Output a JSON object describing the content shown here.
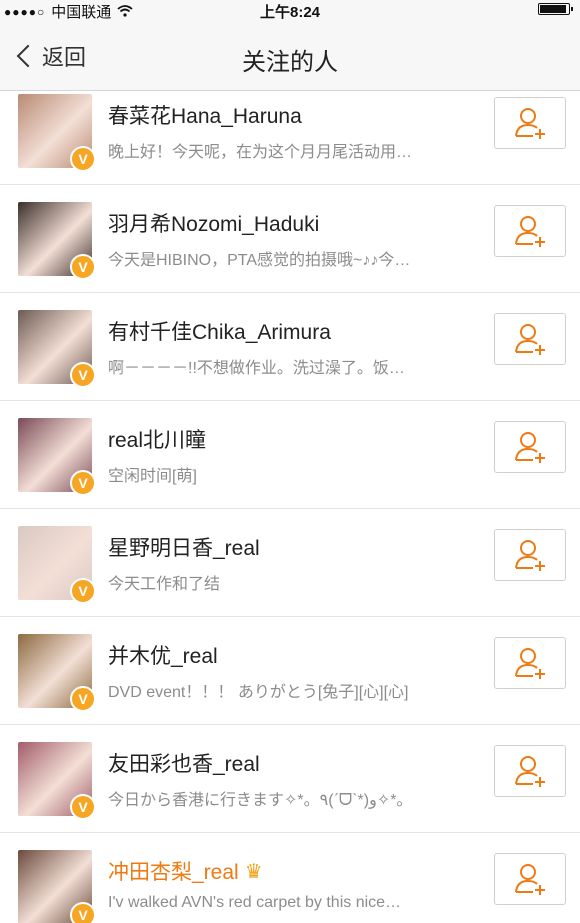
{
  "status_bar": {
    "carrier": "中国联通",
    "signal": "●●●●○",
    "wifi_icon": "wifi-icon",
    "time": "上午8:24",
    "battery_level": 0.85
  },
  "nav": {
    "back_label": "返回",
    "title": "关注的人"
  },
  "colors": {
    "accent_orange": "#f07a12",
    "verified_badge": "#f6a623"
  },
  "users": [
    {
      "name": "春菜花Hana_Haruna",
      "desc": "晚上好！今天呢，在为这个月月尾活动用…",
      "verified": "V",
      "highlight": false,
      "crown": false,
      "avatar_color": "#b98a74"
    },
    {
      "name": "羽月希Nozomi_Haduki",
      "desc": "今天是HIBINO，PTA感觉的拍摄哦~♪♪今…",
      "verified": "V",
      "highlight": false,
      "crown": false,
      "avatar_color": "#3b2f2a"
    },
    {
      "name": "有村千佳Chika_Arimura",
      "desc": "啊－－－－!!不想做作业。洗过澡了。饭…",
      "verified": "V",
      "highlight": false,
      "crown": false,
      "avatar_color": "#6d5a52"
    },
    {
      "name": "real北川瞳",
      "desc": "空闲时间[萌]",
      "verified": "V",
      "highlight": false,
      "crown": false,
      "avatar_color": "#7a4a58"
    },
    {
      "name": "星野明日香_real",
      "desc": "今天工作和了结",
      "verified": "V",
      "highlight": false,
      "crown": false,
      "avatar_color": "#d9c9c3"
    },
    {
      "name": "并木优_real",
      "desc": "DVD event！！！ ありがとう[兔子][心][心]",
      "verified": "V",
      "highlight": false,
      "crown": false,
      "avatar_color": "#8c6a3f"
    },
    {
      "name": "友田彩也香_real",
      "desc": "今日から香港に行きます✧*。٩(ˊᗜˋ*)و✧*。",
      "verified": "V",
      "highlight": false,
      "crown": false,
      "avatar_color": "#a25d6b"
    },
    {
      "name": "冲田杏梨_real",
      "desc": "I'v walked AVN's red carpet by this nice…",
      "verified": "V",
      "highlight": true,
      "crown": true,
      "avatar_color": "#6b4a3c"
    }
  ],
  "icons": {
    "follow": "add-user-icon",
    "crown": "crown-icon",
    "back": "chevron-left-icon"
  }
}
